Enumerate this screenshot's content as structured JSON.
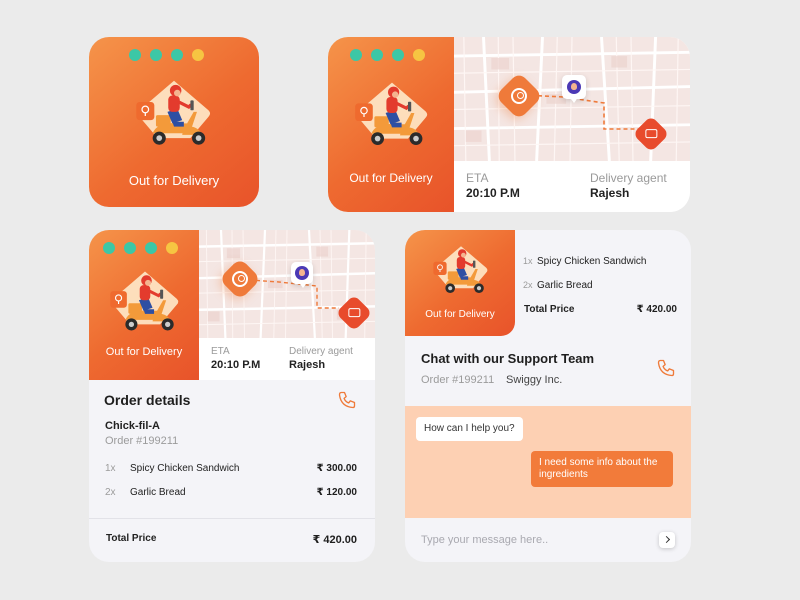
{
  "status": {
    "out_for_delivery": "Out for Delivery"
  },
  "eta": {
    "label": "ETA",
    "value": "20:10 P.M"
  },
  "agent": {
    "label": "Delivery agent",
    "name": "Rajesh"
  },
  "order": {
    "title": "Order details",
    "restaurant": "Chick-fil-A",
    "number": "Order #199211",
    "items": [
      {
        "qty": "1x",
        "name": "Spicy Chicken Sandwich",
        "price": "₹ 300.00"
      },
      {
        "qty": "2x",
        "name": "Garlic Bread",
        "price": "₹ 120.00"
      }
    ],
    "total_label": "Total Price",
    "total_value": "₹ 420.00"
  },
  "chat": {
    "title": "Chat with our Support Team",
    "order_number": "Order #199211",
    "company": "Swiggy Inc.",
    "messages": [
      {
        "from": "support",
        "text": "How can I help you?"
      },
      {
        "from": "user",
        "text": "I need some info about the ingredients"
      }
    ],
    "input_placeholder": "Type your message here.."
  },
  "icons": [
    "store-pin-icon",
    "scooter-rider-illustration",
    "user-location-pin-icon",
    "store-location-pin-icon",
    "avatar-pin-icon",
    "phone-icon",
    "send-icon"
  ],
  "colors": {
    "accent": "#ef7a3a",
    "accent_dark": "#e8532a",
    "dot_teal": "#3cc7a6",
    "dot_yellow": "#f6c542",
    "chat_bg": "#fdd0b3",
    "map_bg": "#f4e6e3"
  }
}
